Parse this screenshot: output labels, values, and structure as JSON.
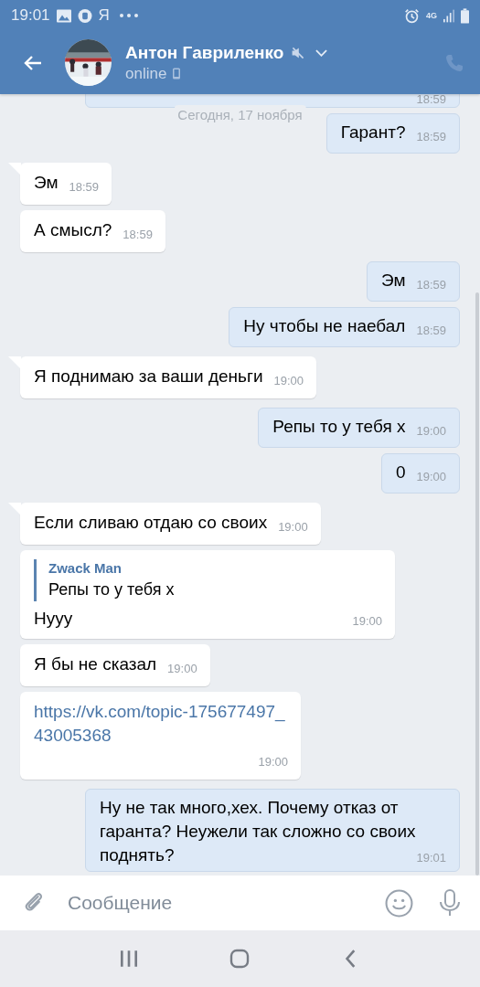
{
  "status_bar": {
    "time": "19:01",
    "app_letter": "Я",
    "network": "4G"
  },
  "header": {
    "name": "Антон Гавриленко",
    "muted": true,
    "status": "online"
  },
  "date_divider": "Сегодня, 17 ноября",
  "messages": [
    {
      "kind": "cut",
      "outgoing": true,
      "tail": false,
      "time": "18:59"
    },
    {
      "kind": "text",
      "outgoing": true,
      "tail": false,
      "text": "Гарант?",
      "time": "18:59"
    },
    {
      "kind": "text",
      "outgoing": false,
      "tail": true,
      "text": "Эм",
      "time": "18:59"
    },
    {
      "kind": "text",
      "outgoing": false,
      "tail": false,
      "text": "А смысл?",
      "time": "18:59"
    },
    {
      "kind": "text",
      "outgoing": true,
      "tail": false,
      "text": "Эм",
      "time": "18:59"
    },
    {
      "kind": "text",
      "outgoing": true,
      "tail": false,
      "text": "Ну чтобы не наебал",
      "time": "18:59"
    },
    {
      "kind": "text",
      "outgoing": false,
      "tail": true,
      "text": "Я поднимаю за ваши деньги",
      "time": "19:00"
    },
    {
      "kind": "text",
      "outgoing": true,
      "tail": false,
      "text": "Репы то у тебя х",
      "time": "19:00"
    },
    {
      "kind": "text",
      "outgoing": true,
      "tail": false,
      "text": "0",
      "time": "19:00"
    },
    {
      "kind": "text",
      "outgoing": false,
      "tail": true,
      "text": "Если сливаю отдаю со своих",
      "time": "19:00"
    },
    {
      "kind": "reply",
      "outgoing": false,
      "tail": false,
      "reply": {
        "author": "Zwack Man",
        "text": "Репы то у тебя х"
      },
      "text": "Нууу",
      "time": "19:00"
    },
    {
      "kind": "text",
      "outgoing": false,
      "tail": false,
      "text": "Я бы не сказал",
      "time": "19:00"
    },
    {
      "kind": "link",
      "outgoing": false,
      "tail": false,
      "text": "https://vk.com/topic-175677497_43005368",
      "time": "19:00"
    },
    {
      "kind": "long",
      "outgoing": true,
      "tail": false,
      "text": "Ну не так много,хех. Почему отказ от гаранта? Неужели так сложно со своих поднять?",
      "time": "19:01"
    }
  ],
  "composer": {
    "placeholder": "Сообщение"
  }
}
